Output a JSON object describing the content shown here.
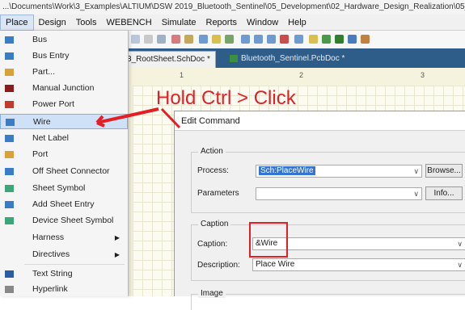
{
  "window": {
    "path": "...\\Documents\\Work\\3_Examples\\ALTIUM\\DSW 2019_Bluetooth_Sentinel\\05_Development\\02_Hardware_Design_Realization\\05_Design"
  },
  "menubar": [
    "Place",
    "Design",
    "Tools",
    "WEBENCH",
    "Simulate",
    "Reports",
    "Window",
    "Help"
  ],
  "tabs": {
    "schematic": "3_RootSheet.SchDoc *",
    "pcb": "Bluetooth_Sentinel.PcbDoc *"
  },
  "ruler": {
    "marks": [
      "1",
      "2",
      "3"
    ]
  },
  "menu": {
    "items": [
      {
        "label": "Bus",
        "icon": "bus-icon",
        "color": "#3a7dc4"
      },
      {
        "label": "Bus Entry",
        "icon": "bus-entry-icon",
        "color": "#3a7dc4"
      },
      {
        "label": "Part...",
        "icon": "part-icon",
        "color": "#d8a13a"
      },
      {
        "label": "Manual Junction",
        "icon": "junction-icon",
        "color": "#8a1c1c"
      },
      {
        "label": "Power Port",
        "icon": "power-port-icon",
        "color": "#c23a2a"
      },
      {
        "label": "Wire",
        "icon": "wire-icon",
        "color": "#3a7dc4"
      },
      {
        "label": "Net Label",
        "icon": "net-label-icon",
        "color": "#3a7dc4"
      },
      {
        "label": "Port",
        "icon": "port-icon",
        "color": "#d8a13a"
      },
      {
        "label": "Off Sheet Connector",
        "icon": "off-sheet-connector-icon",
        "color": "#3a7dc4"
      },
      {
        "label": "Sheet Symbol",
        "icon": "sheet-symbol-icon",
        "color": "#3aa67a"
      },
      {
        "label": "Add Sheet Entry",
        "icon": "sheet-entry-icon",
        "color": "#3a7dc4"
      },
      {
        "label": "Device Sheet Symbol",
        "icon": "device-sheet-icon",
        "color": "#3aa67a"
      },
      {
        "label": "Harness",
        "icon": "",
        "color": "#f5f5f5",
        "submenu": true
      },
      {
        "label": "Directives",
        "icon": "",
        "color": "#f5f5f5",
        "submenu": true
      },
      {
        "label": "Text String",
        "icon": "text-string-icon",
        "color": "#2b5da3"
      },
      {
        "label": "Hyperlink",
        "icon": "hyperlink-icon",
        "color": "#888888"
      }
    ],
    "selected_index": 5
  },
  "annotation": {
    "text": "Hold Ctrl > Click",
    "color": "#e31e24"
  },
  "dialog": {
    "title": "Edit Command",
    "action_group": "Action",
    "process_label": "Process:",
    "process_value": "Sch:PlaceWire",
    "browse_button": "Browse...",
    "parameters_label": "Parameters",
    "info_button": "Info...",
    "caption_group": "Caption",
    "caption_label": "Caption:",
    "caption_value": "&Wire",
    "description_label": "Description:",
    "description_value": "Place Wire",
    "image_group": "Image"
  }
}
